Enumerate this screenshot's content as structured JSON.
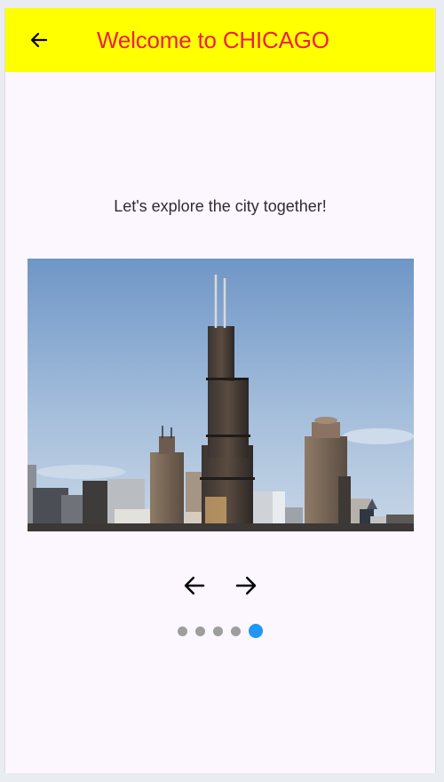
{
  "appbar": {
    "title": "Welcome to CHICAGO",
    "back_icon": "arrow-left-icon",
    "background": "#ffff00",
    "title_color": "#ee1f46"
  },
  "content": {
    "tagline": "Let's explore the city together!",
    "image": {
      "subject": "Chicago skyline with Willis Tower",
      "icon": "skyline-photo"
    }
  },
  "carousel": {
    "prev_icon": "arrow-left-icon",
    "next_icon": "arrow-right-icon",
    "page_count": 5,
    "active_page": 5,
    "active_color": "#2196f3",
    "inactive_color": "#9e9e9e"
  }
}
